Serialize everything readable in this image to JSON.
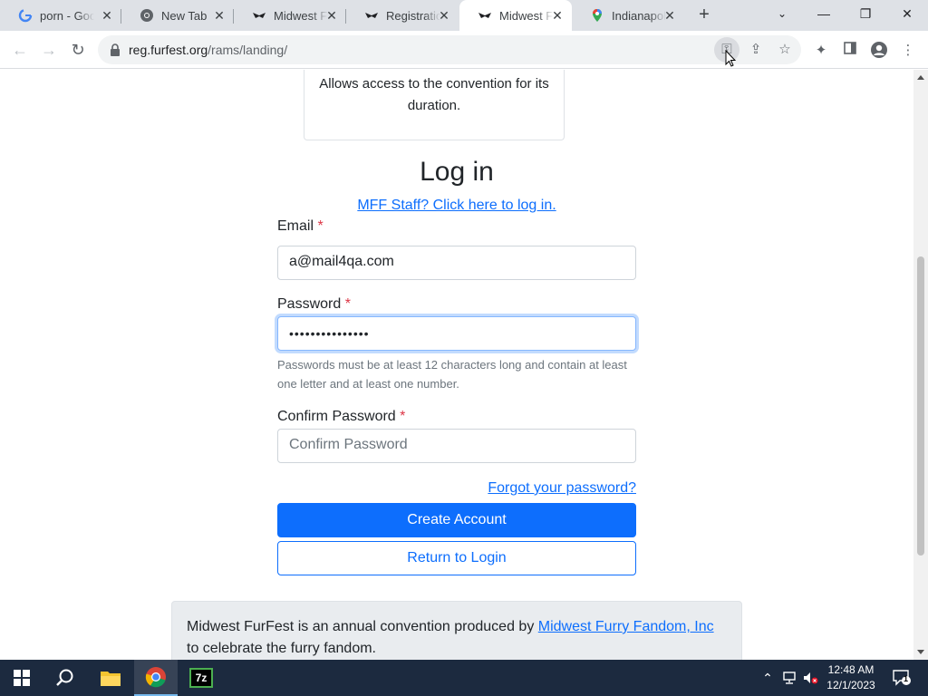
{
  "browser": {
    "tabs": [
      {
        "title": "porn - Goo",
        "favicon": "google-icon",
        "active": false
      },
      {
        "title": "New Tab",
        "favicon": "chrome-icon",
        "active": false
      },
      {
        "title": "Midwest Fu",
        "favicon": "mff-icon",
        "active": false
      },
      {
        "title": "Registratio",
        "favicon": "mff-icon",
        "active": false
      },
      {
        "title": "Midwest Fu",
        "favicon": "mff-icon",
        "active": true
      },
      {
        "title": "Indianapoli",
        "favicon": "maps-pin-icon",
        "active": false
      }
    ],
    "url_host": "reg.furfest.org",
    "url_path": "/rams/landing/"
  },
  "page": {
    "info_card_text": "Allows access to the convention for its duration.",
    "heading": "Log in",
    "staff_link": "MFF Staff? Click here to log in.",
    "email_label": "Email",
    "email_value": "a@mail4qa.com",
    "password_label": "Password",
    "password_value": "•••••••••••••••",
    "password_help": "Passwords must be at least 12 characters long and contain at least one letter and at least one number.",
    "confirm_label": "Confirm Password",
    "confirm_placeholder": "Confirm Password",
    "required_marker": "*",
    "forgot_link": "Forgot your password?",
    "create_button": "Create Account",
    "return_button": "Return to Login",
    "footer_text_before": "Midwest FurFest is an annual convention produced by ",
    "footer_link": "Midwest Furry Fandom, Inc",
    "footer_text_after": " to celebrate the furry fandom."
  },
  "taskbar": {
    "time": "12:48 AM",
    "date": "12/1/2023",
    "notification_count": "1"
  },
  "colors": {
    "primary": "#0d6efd",
    "required": "#dc3545",
    "taskbar": "#1c2a3f"
  }
}
